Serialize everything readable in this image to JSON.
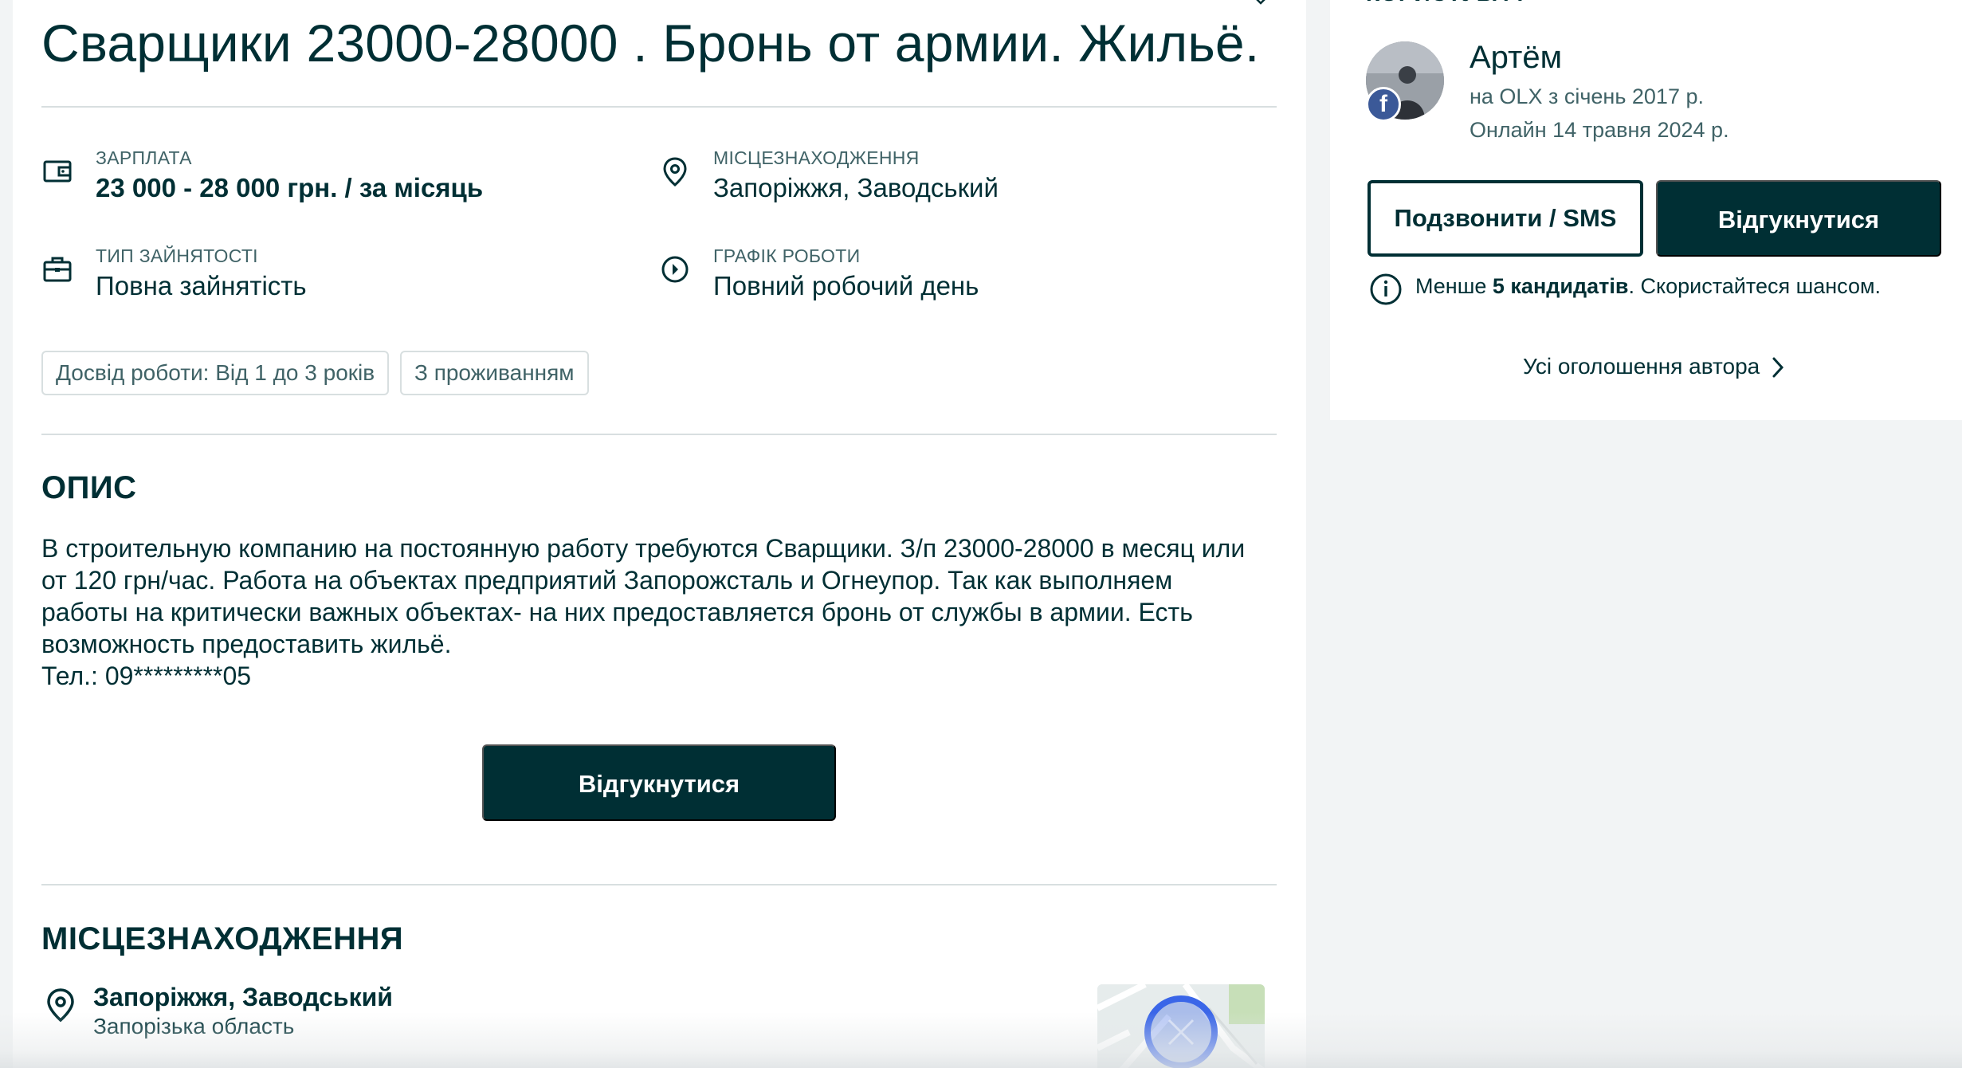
{
  "ad": {
    "title": "Сварщики 23000-28000 . Бронь от армии. Жильё."
  },
  "params": {
    "salary": {
      "label": "ЗАРПЛАТА",
      "value": "23 000 - 28 000 грн. / за місяць"
    },
    "location": {
      "label": "МІСЦЕЗНАХОДЖЕННЯ",
      "value": "Запоріжжя, Заводський"
    },
    "employment": {
      "label": "ТИП ЗАЙНЯТОСТІ",
      "value": "Повна зайнятість"
    },
    "schedule": {
      "label": "ГРАФІК РОБОТИ",
      "value": "Повний робочий день"
    }
  },
  "tags": [
    "Досвід роботи: Від 1 до 3 років",
    "З проживанням"
  ],
  "description": {
    "heading": "ОПИС",
    "lines": [
      "В строительную компанию на постоянную работу требуются Сварщики. З/п 23000-28000 в месяц или",
      "от 120 грн/час. Работа на объектах предприятий Запорожсталь и Огнеупор. Так как выполняем",
      "работы на критически важных объектах- на них предоставляется бронь от службы в армии. Есть",
      "возможность предоставить жильё.",
      "Тел.: 09*********05"
    ],
    "apply_label": "Відгукнутися"
  },
  "location_section": {
    "heading": "МІСЦЕЗНАХОДЖЕННЯ",
    "city": "Запоріжжя, Заводський",
    "region": "Запорізька область"
  },
  "user": {
    "heading": "КОРИСТУВАЧ",
    "name": "Артём",
    "since": "на OLX з січень 2017 р.",
    "online": "Онлайн 14 травня 2024 р.",
    "fb_letter": "f",
    "call_label": "Подзвонити / SMS",
    "apply_label": "Відгукнутися",
    "candidates_prefix": "Менше ",
    "candidates_bold": "5 кандидатів",
    "candidates_suffix": ". Скористайтеся шансом.",
    "all_ads_label": "Усі оголошення автора"
  },
  "colors": {
    "primary": "#002f34",
    "muted": "#406367",
    "divider": "#d8dfe0",
    "map_marker": "#3a66e8"
  }
}
